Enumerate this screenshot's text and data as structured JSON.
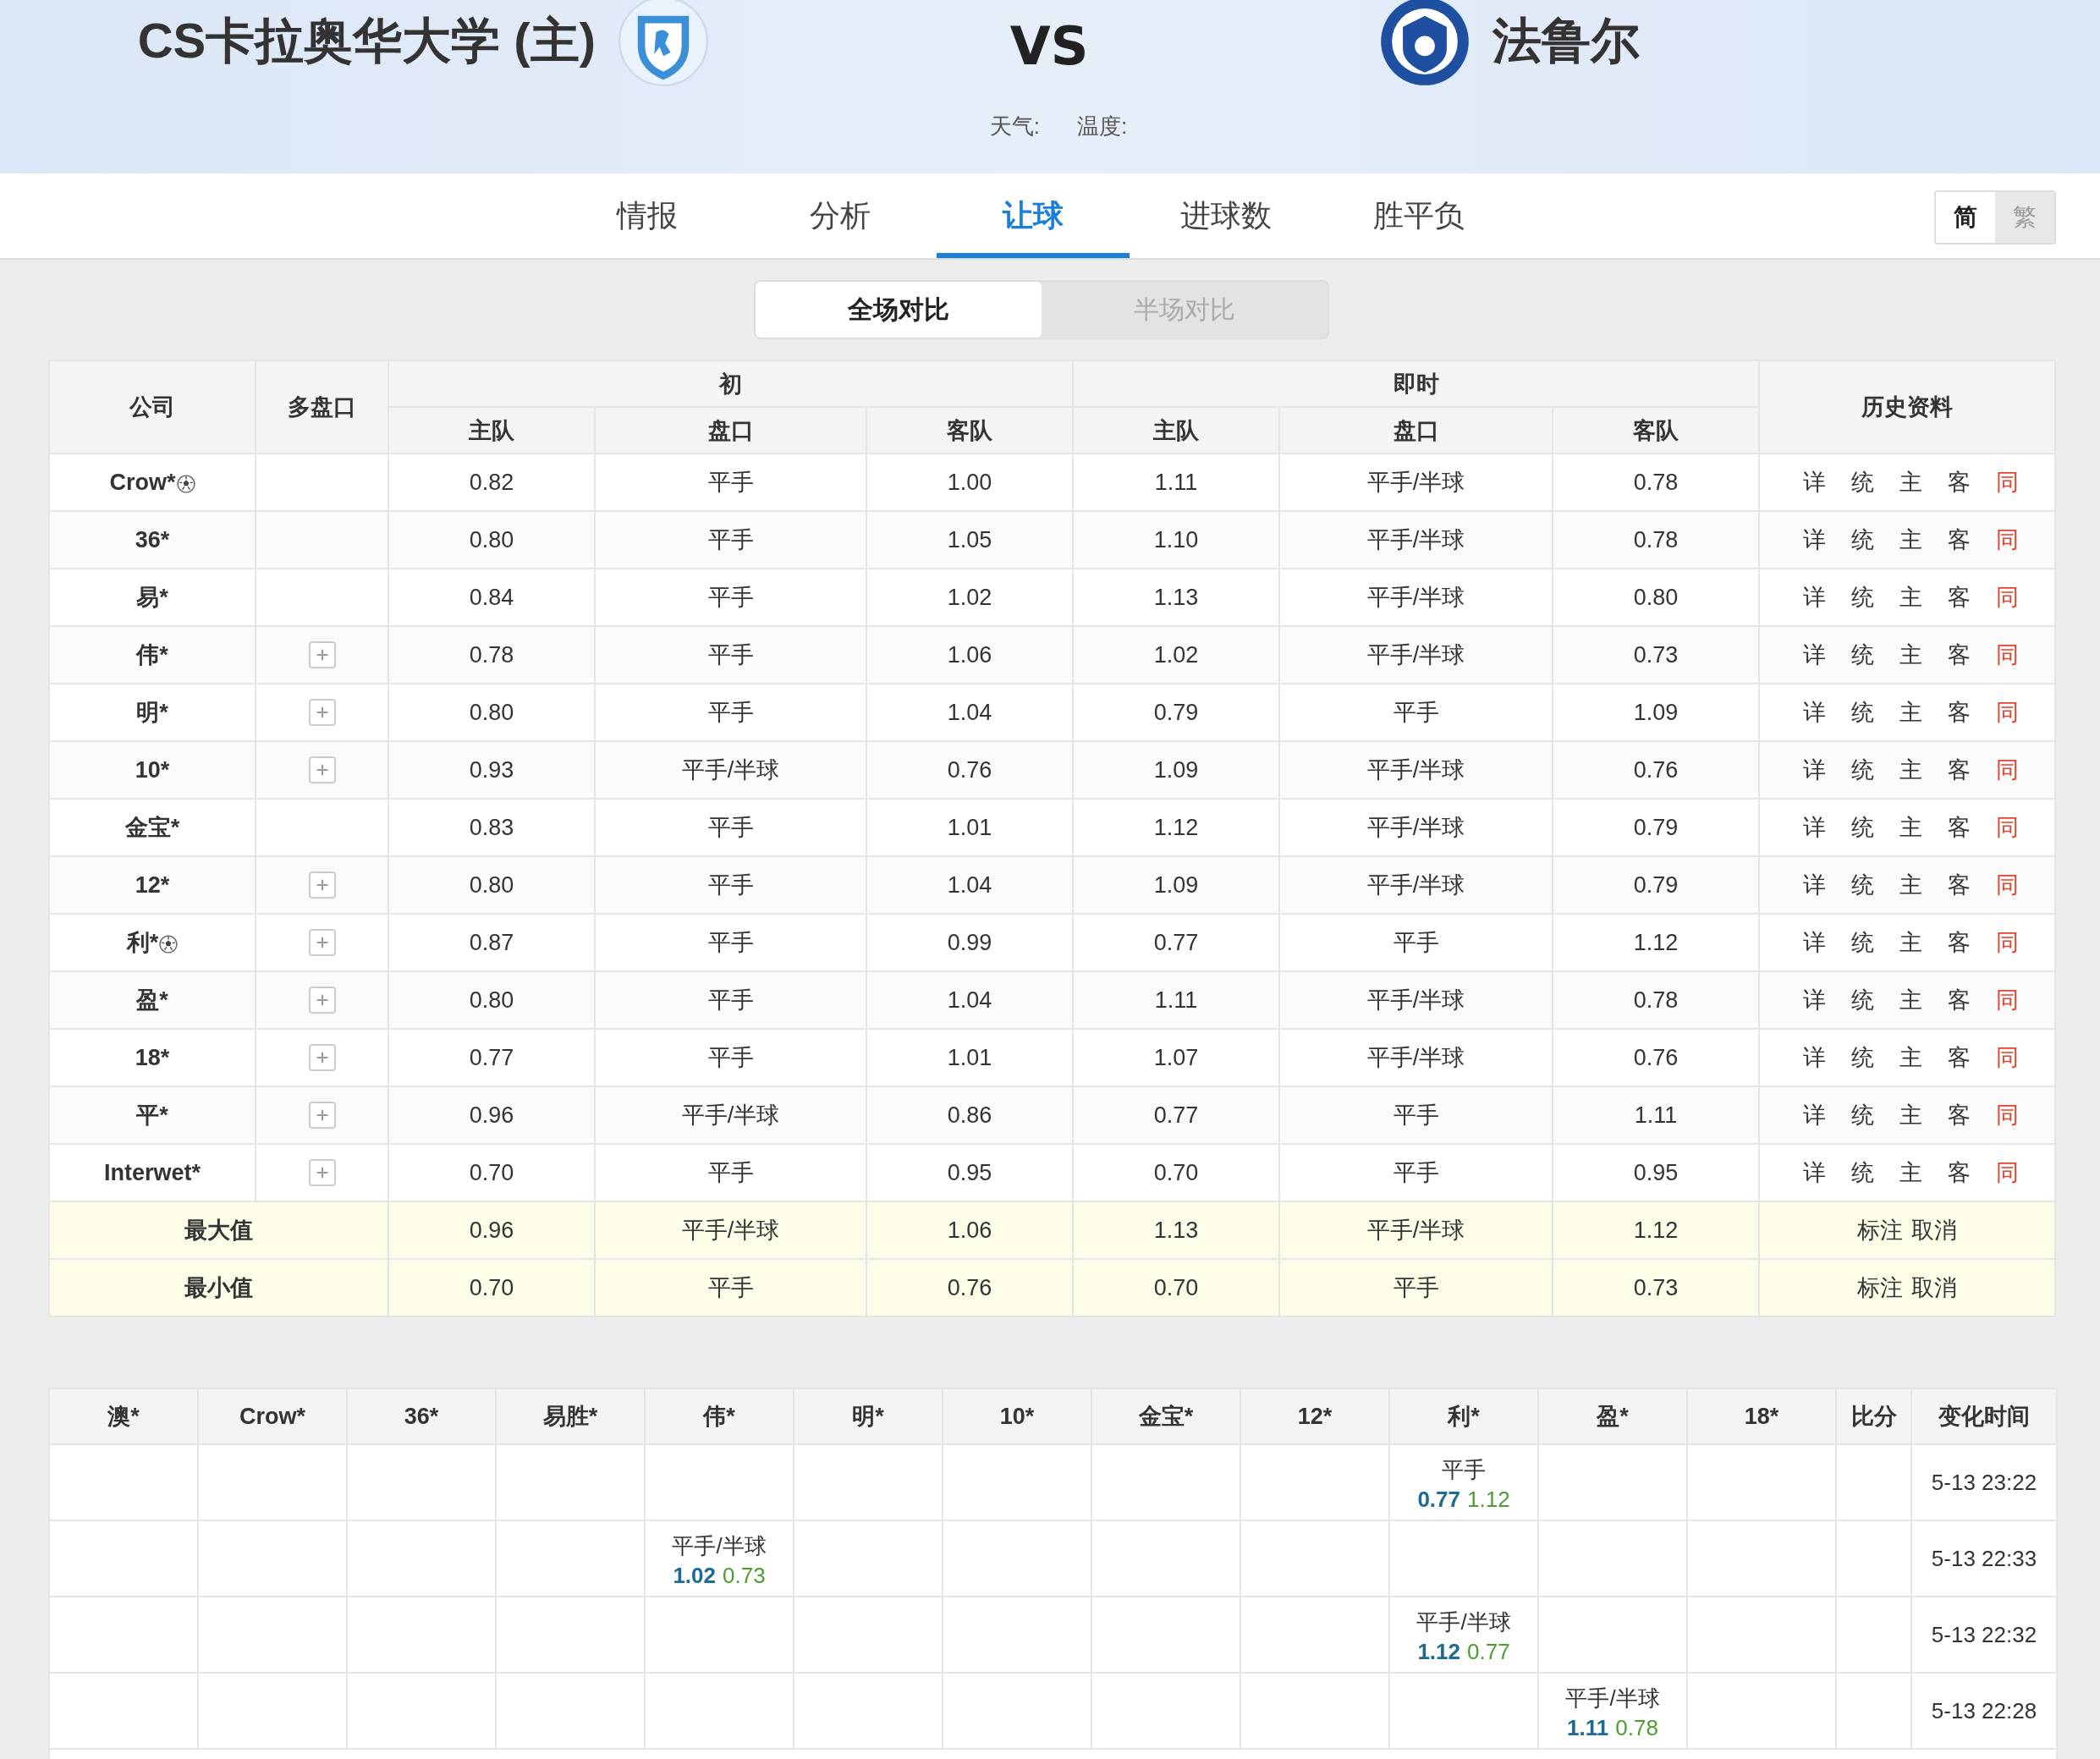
{
  "header": {
    "home_team": "CS卡拉奥华大学 (主)",
    "vs": "VS",
    "away_team": "法鲁尔",
    "weather_label": "天气:",
    "temperature_label": "温度:"
  },
  "tabs": [
    {
      "label": "情报",
      "selected": false
    },
    {
      "label": "分析",
      "selected": false
    },
    {
      "label": "让球",
      "selected": true
    },
    {
      "label": "进球数",
      "selected": false
    },
    {
      "label": "胜平负",
      "selected": false
    }
  ],
  "script_toggle": [
    {
      "label": "简",
      "selected": true
    },
    {
      "label": "繁",
      "selected": false
    }
  ],
  "compare_toggle": [
    {
      "label": "全场对比",
      "selected": true
    },
    {
      "label": "半场对比",
      "selected": false
    }
  ],
  "odds_table": {
    "company_header": "公司",
    "multi_header": "多盘口",
    "initial_header": "初",
    "live_header": "即时",
    "history_header": "历史资料",
    "initial_columns": [
      "主队",
      "盘口",
      "客队"
    ],
    "live_columns": [
      "主队",
      "盘口",
      "客队"
    ],
    "rows": [
      {
        "company": "Crow*",
        "ball_mark": true,
        "multi": false,
        "initial": [
          "0.82",
          "平手",
          "1.00"
        ],
        "live": [
          "1.11",
          "平手/半球",
          "0.78"
        ],
        "history": [
          {
            "label": "详",
            "color": "#333333"
          },
          {
            "label": "统",
            "color": "#333333"
          },
          {
            "label": "主",
            "color": "#333333"
          },
          {
            "label": "客",
            "color": "#333333"
          },
          {
            "label": "同",
            "color": "#e8432c"
          }
        ]
      },
      {
        "company": "36*",
        "ball_mark": false,
        "multi": false,
        "initial": [
          "0.80",
          "平手",
          "1.05"
        ],
        "live": [
          "1.10",
          "平手/半球",
          "0.78"
        ],
        "history": [
          {
            "label": "详",
            "color": "#333333"
          },
          {
            "label": "统",
            "color": "#333333"
          },
          {
            "label": "主",
            "color": "#333333"
          },
          {
            "label": "客",
            "color": "#333333"
          },
          {
            "label": "同",
            "color": "#e8432c"
          }
        ]
      },
      {
        "company": "易*",
        "ball_mark": false,
        "multi": false,
        "initial": [
          "0.84",
          "平手",
          "1.02"
        ],
        "live": [
          "1.13",
          "平手/半球",
          "0.80"
        ],
        "history": [
          {
            "label": "详",
            "color": "#333333"
          },
          {
            "label": "统",
            "color": "#333333"
          },
          {
            "label": "主",
            "color": "#333333"
          },
          {
            "label": "客",
            "color": "#333333"
          },
          {
            "label": "同",
            "color": "#e8432c"
          }
        ]
      },
      {
        "company": "伟*",
        "ball_mark": false,
        "multi": true,
        "initial": [
          "0.78",
          "平手",
          "1.06"
        ],
        "live": [
          "1.02",
          "平手/半球",
          "0.73"
        ],
        "history": [
          {
            "label": "详",
            "color": "#333333"
          },
          {
            "label": "统",
            "color": "#333333"
          },
          {
            "label": "主",
            "color": "#333333"
          },
          {
            "label": "客",
            "color": "#333333"
          },
          {
            "label": "同",
            "color": "#e8432c"
          }
        ]
      },
      {
        "company": "明*",
        "ball_mark": false,
        "multi": true,
        "initial": [
          "0.80",
          "平手",
          "1.04"
        ],
        "live": [
          "0.79",
          "平手",
          "1.09"
        ],
        "history": [
          {
            "label": "详",
            "color": "#333333"
          },
          {
            "label": "统",
            "color": "#333333"
          },
          {
            "label": "主",
            "color": "#333333"
          },
          {
            "label": "客",
            "color": "#333333"
          },
          {
            "label": "同",
            "color": "#e8432c"
          }
        ]
      },
      {
        "company": "10*",
        "ball_mark": false,
        "multi": true,
        "initial": [
          "0.93",
          "平手/半球",
          "0.76"
        ],
        "live": [
          "1.09",
          "平手/半球",
          "0.76"
        ],
        "history": [
          {
            "label": "详",
            "color": "#333333"
          },
          {
            "label": "统",
            "color": "#333333"
          },
          {
            "label": "主",
            "color": "#333333"
          },
          {
            "label": "客",
            "color": "#333333"
          },
          {
            "label": "同",
            "color": "#e8432c"
          }
        ]
      },
      {
        "company": "金宝*",
        "ball_mark": false,
        "multi": false,
        "initial": [
          "0.83",
          "平手",
          "1.01"
        ],
        "live": [
          "1.12",
          "平手/半球",
          "0.79"
        ],
        "history": [
          {
            "label": "详",
            "color": "#333333"
          },
          {
            "label": "统",
            "color": "#333333"
          },
          {
            "label": "主",
            "color": "#333333"
          },
          {
            "label": "客",
            "color": "#333333"
          },
          {
            "label": "同",
            "color": "#e8432c"
          }
        ]
      },
      {
        "company": "12*",
        "ball_mark": false,
        "multi": true,
        "initial": [
          "0.80",
          "平手",
          "1.04"
        ],
        "live": [
          "1.09",
          "平手/半球",
          "0.79"
        ],
        "history": [
          {
            "label": "详",
            "color": "#333333"
          },
          {
            "label": "统",
            "color": "#333333"
          },
          {
            "label": "主",
            "color": "#333333"
          },
          {
            "label": "客",
            "color": "#333333"
          },
          {
            "label": "同",
            "color": "#e8432c"
          }
        ]
      },
      {
        "company": "利*",
        "ball_mark": true,
        "multi": true,
        "initial": [
          "0.87",
          "平手",
          "0.99"
        ],
        "live": [
          "0.77",
          "平手",
          "1.12"
        ],
        "history": [
          {
            "label": "详",
            "color": "#333333"
          },
          {
            "label": "统",
            "color": "#333333"
          },
          {
            "label": "主",
            "color": "#333333"
          },
          {
            "label": "客",
            "color": "#333333"
          },
          {
            "label": "同",
            "color": "#e8432c"
          }
        ]
      },
      {
        "company": "盈*",
        "ball_mark": false,
        "multi": true,
        "initial": [
          "0.80",
          "平手",
          "1.04"
        ],
        "live": [
          "1.11",
          "平手/半球",
          "0.78"
        ],
        "history": [
          {
            "label": "详",
            "color": "#333333"
          },
          {
            "label": "统",
            "color": "#333333"
          },
          {
            "label": "主",
            "color": "#333333"
          },
          {
            "label": "客",
            "color": "#333333"
          },
          {
            "label": "同",
            "color": "#e8432c"
          }
        ]
      },
      {
        "company": "18*",
        "ball_mark": false,
        "multi": true,
        "initial": [
          "0.77",
          "平手",
          "1.01"
        ],
        "live": [
          "1.07",
          "平手/半球",
          "0.76"
        ],
        "history": [
          {
            "label": "详",
            "color": "#333333"
          },
          {
            "label": "统",
            "color": "#333333"
          },
          {
            "label": "主",
            "color": "#333333"
          },
          {
            "label": "客",
            "color": "#333333"
          },
          {
            "label": "同",
            "color": "#e8432c"
          }
        ]
      },
      {
        "company": "平*",
        "ball_mark": false,
        "multi": true,
        "initial": [
          "0.96",
          "平手/半球",
          "0.86"
        ],
        "live": [
          "0.77",
          "平手",
          "1.11"
        ],
        "history": [
          {
            "label": "详",
            "color": "#333333"
          },
          {
            "label": "统",
            "color": "#333333"
          },
          {
            "label": "主",
            "color": "#333333"
          },
          {
            "label": "客",
            "color": "#333333"
          },
          {
            "label": "同",
            "color": "#e8432c"
          }
        ]
      },
      {
        "company": "Interwet*",
        "ball_mark": false,
        "multi": true,
        "initial": [
          "0.70",
          "平手",
          "0.95"
        ],
        "live": [
          "0.70",
          "平手",
          "0.95"
        ],
        "history": [
          {
            "label": "详",
            "color": "#333333"
          },
          {
            "label": "统",
            "color": "#333333"
          },
          {
            "label": "主",
            "color": "#333333"
          },
          {
            "label": "客",
            "color": "#333333"
          },
          {
            "label": "同",
            "color": "#e8432c"
          }
        ]
      }
    ],
    "summary_rows": [
      {
        "label": "最大值",
        "values": [
          "0.96",
          "平手/半球",
          "1.06",
          "1.13",
          "平手/半球",
          "1.12"
        ],
        "actions": [
          "标注",
          "取消"
        ]
      },
      {
        "label": "最小值",
        "values": [
          "0.70",
          "平手",
          "0.76",
          "0.70",
          "平手",
          "0.73"
        ],
        "actions": [
          "标注",
          "取消"
        ]
      }
    ]
  },
  "change_table": {
    "columns": [
      "澳*",
      "Crow*",
      "36*",
      "易胜*",
      "伟*",
      "明*",
      "10*",
      "金宝*",
      "12*",
      "利*",
      "盈*",
      "18*",
      "比分",
      "变化时间"
    ],
    "rows": [
      {
        "cells": [
          {
            "kind": "empty"
          },
          {
            "kind": "empty"
          },
          {
            "kind": "empty"
          },
          {
            "kind": "empty"
          },
          {
            "kind": "empty"
          },
          {
            "kind": "empty"
          },
          {
            "kind": "empty"
          },
          {
            "kind": "empty"
          },
          {
            "kind": "empty"
          },
          {
            "kind": "odds",
            "line": "平手",
            "home": "0.77",
            "away": "1.12"
          },
          {
            "kind": "empty"
          },
          {
            "kind": "empty"
          },
          {
            "kind": "empty"
          }
        ],
        "time": "5-13 23:22"
      },
      {
        "cells": [
          {
            "kind": "empty"
          },
          {
            "kind": "empty"
          },
          {
            "kind": "empty"
          },
          {
            "kind": "empty"
          },
          {
            "kind": "odds",
            "line": "平手/半球",
            "home": "1.02",
            "away": "0.73"
          },
          {
            "kind": "empty"
          },
          {
            "kind": "empty"
          },
          {
            "kind": "empty"
          },
          {
            "kind": "empty"
          },
          {
            "kind": "empty"
          },
          {
            "kind": "empty"
          },
          {
            "kind": "empty"
          },
          {
            "kind": "empty"
          }
        ],
        "time": "5-13 22:33"
      },
      {
        "cells": [
          {
            "kind": "empty"
          },
          {
            "kind": "empty"
          },
          {
            "kind": "empty"
          },
          {
            "kind": "empty"
          },
          {
            "kind": "empty"
          },
          {
            "kind": "empty"
          },
          {
            "kind": "empty"
          },
          {
            "kind": "empty"
          },
          {
            "kind": "empty"
          },
          {
            "kind": "odds",
            "line": "平手/半球",
            "home": "1.12",
            "away": "0.77"
          },
          {
            "kind": "empty"
          },
          {
            "kind": "empty"
          },
          {
            "kind": "empty"
          }
        ],
        "time": "5-13 22:32"
      },
      {
        "cells": [
          {
            "kind": "empty"
          },
          {
            "kind": "empty"
          },
          {
            "kind": "empty"
          },
          {
            "kind": "empty"
          },
          {
            "kind": "empty"
          },
          {
            "kind": "empty"
          },
          {
            "kind": "empty"
          },
          {
            "kind": "empty"
          },
          {
            "kind": "empty"
          },
          {
            "kind": "empty"
          },
          {
            "kind": "odds",
            "line": "平手/半球",
            "home": "1.11",
            "away": "0.78"
          },
          {
            "kind": "empty"
          },
          {
            "kind": "empty"
          }
        ],
        "time": "5-13 22:28"
      }
    ]
  }
}
